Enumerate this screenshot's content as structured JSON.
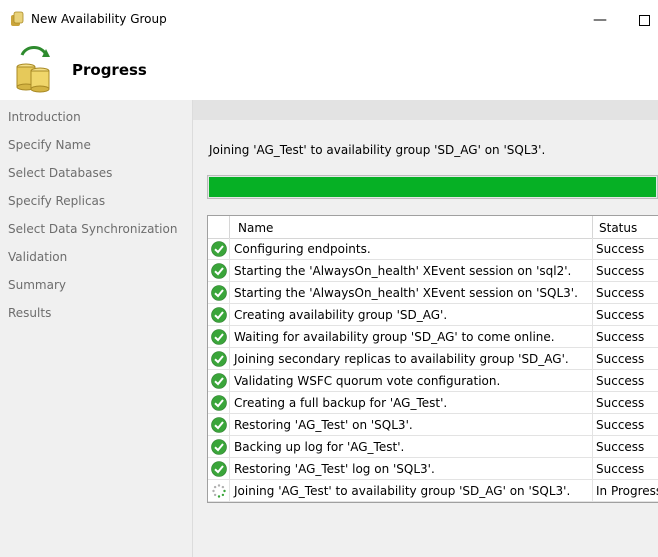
{
  "window": {
    "title": "New Availability Group",
    "minimize_glyph": "—",
    "maximize_glyph": "□"
  },
  "header": {
    "page_title": "Progress",
    "icon": "availability-group-icon"
  },
  "sidebar": {
    "items": [
      {
        "label": "Introduction"
      },
      {
        "label": "Specify Name"
      },
      {
        "label": "Select Databases"
      },
      {
        "label": "Specify Replicas"
      },
      {
        "label": "Select Data Synchronization"
      },
      {
        "label": "Validation"
      },
      {
        "label": "Summary"
      },
      {
        "label": "Results"
      }
    ]
  },
  "main": {
    "status_message": "Joining 'AG_Test' to availability group 'SD_AG' on 'SQL3'.",
    "progress_fraction": 1.0,
    "progress_color": "#06b025",
    "grid": {
      "columns": {
        "name": "Name",
        "status": "Status"
      },
      "rows": [
        {
          "name": "Configuring endpoints.",
          "status": "Success",
          "state": "success"
        },
        {
          "name": "Starting the 'AlwaysOn_health' XEvent session on 'sql2'.",
          "status": "Success",
          "state": "success"
        },
        {
          "name": "Starting the 'AlwaysOn_health' XEvent session on 'SQL3'.",
          "status": "Success",
          "state": "success"
        },
        {
          "name": "Creating availability group 'SD_AG'.",
          "status": "Success",
          "state": "success"
        },
        {
          "name": "Waiting for availability group 'SD_AG' to come online.",
          "status": "Success",
          "state": "success"
        },
        {
          "name": "Joining secondary replicas to availability group 'SD_AG'.",
          "status": "Success",
          "state": "success"
        },
        {
          "name": "Validating WSFC quorum vote configuration.",
          "status": "Success",
          "state": "success"
        },
        {
          "name": "Creating a full backup for 'AG_Test'.",
          "status": "Success",
          "state": "success"
        },
        {
          "name": "Restoring 'AG_Test' on 'SQL3'.",
          "status": "Success",
          "state": "success"
        },
        {
          "name": "Backing up log for 'AG_Test'.",
          "status": "Success",
          "state": "success"
        },
        {
          "name": "Restoring 'AG_Test' log on 'SQL3'.",
          "status": "Success",
          "state": "success"
        },
        {
          "name": "Joining 'AG_Test' to availability group 'SD_AG' on 'SQL3'.",
          "status": "In Progress",
          "state": "in-progress"
        }
      ]
    }
  },
  "colors": {
    "success_icon": "#3aa53a",
    "sidebar_text": "#6d6d6d"
  }
}
